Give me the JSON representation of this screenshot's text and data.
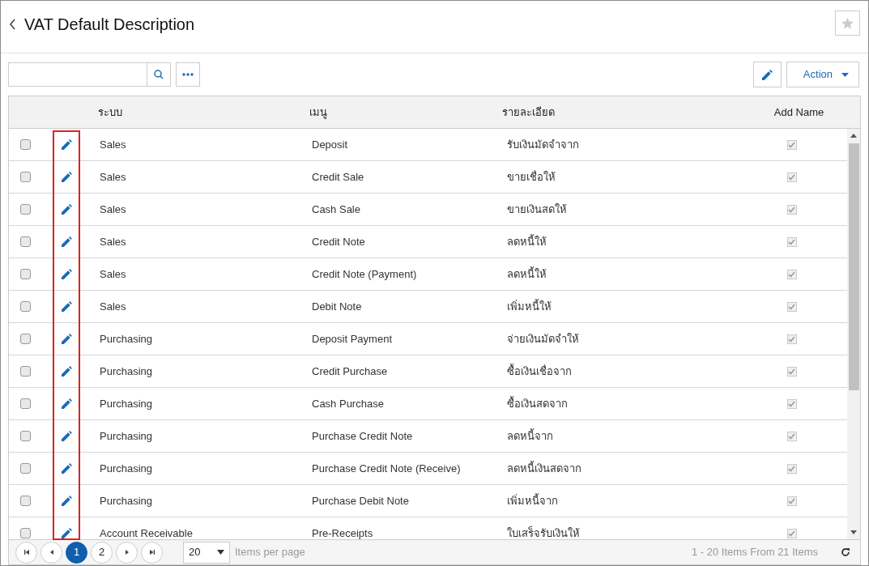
{
  "title": "VAT Default Description",
  "toolbar": {
    "action_label": "Action"
  },
  "table": {
    "columns": [
      "ระบบ",
      "เมนู",
      "รายละเอียด",
      "Add Name"
    ],
    "edit_column_highlighted": true,
    "rows": [
      {
        "checked": false,
        "system": "Sales",
        "menu": "Deposit",
        "description": "รับเงินมัดจำจาก",
        "add_name": true
      },
      {
        "checked": false,
        "system": "Sales",
        "menu": "Credit Sale",
        "description": "ขายเชื่อให้",
        "add_name": true
      },
      {
        "checked": false,
        "system": "Sales",
        "menu": "Cash Sale",
        "description": "ขายเงินสดให้",
        "add_name": true
      },
      {
        "checked": false,
        "system": "Sales",
        "menu": "Credit Note",
        "description": "ลดหนี้ให้",
        "add_name": true
      },
      {
        "checked": false,
        "system": "Sales",
        "menu": "Credit Note (Payment)",
        "description": "ลดหนี้ให้",
        "add_name": true
      },
      {
        "checked": false,
        "system": "Sales",
        "menu": "Debit Note",
        "description": "เพิ่มหนี้ให้",
        "add_name": true
      },
      {
        "checked": false,
        "system": "Purchasing",
        "menu": "Deposit Payment",
        "description": "จ่ายเงินมัดจำให้",
        "add_name": true
      },
      {
        "checked": false,
        "system": "Purchasing",
        "menu": "Credit Purchase",
        "description": "ซื้อเงินเชื่อจาก",
        "add_name": true
      },
      {
        "checked": false,
        "system": "Purchasing",
        "menu": "Cash Purchase",
        "description": "ซื้อเงินสดจาก",
        "add_name": true
      },
      {
        "checked": false,
        "system": "Purchasing",
        "menu": "Purchase Credit Note",
        "description": "ลดหนี้จาก",
        "add_name": true
      },
      {
        "checked": false,
        "system": "Purchasing",
        "menu": "Purchase Credit Note (Receive)",
        "description": "ลดหนี้เงินสดจาก",
        "add_name": true
      },
      {
        "checked": false,
        "system": "Purchasing",
        "menu": "Purchase Debit Note",
        "description": "เพิ่มหนี้จาก",
        "add_name": true
      },
      {
        "checked": false,
        "system": "Account Receivable",
        "menu": "Pre-Receipts",
        "description": "ใบเสร็จรับเงินให้",
        "add_name": true
      }
    ]
  },
  "pager": {
    "pages": [
      {
        "label": "1",
        "selected": true
      },
      {
        "label": "2",
        "selected": false
      }
    ],
    "page_size": "20",
    "page_size_label": "Items per page",
    "summary": "1 - 20 Items From 21 Items"
  }
}
